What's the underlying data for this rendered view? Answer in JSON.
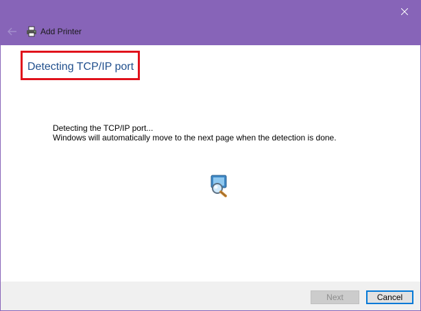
{
  "window": {
    "title": "Add Printer",
    "accent_color": "#8764b8"
  },
  "titlebar": {
    "back_icon": "back-arrow-icon",
    "app_icon": "printer-icon",
    "close_icon": "close-icon"
  },
  "page": {
    "heading": "Detecting TCP/IP port",
    "heading_highlight_color": "#e0111b",
    "message_line1": "Detecting the TCP/IP port...",
    "message_line2": "Windows will automatically move to the next page when the detection is done.",
    "status_icon": "network-search-icon"
  },
  "footer": {
    "next_label": "Next",
    "cancel_label": "Cancel",
    "next_enabled": false,
    "focus_color": "#0078d7"
  }
}
